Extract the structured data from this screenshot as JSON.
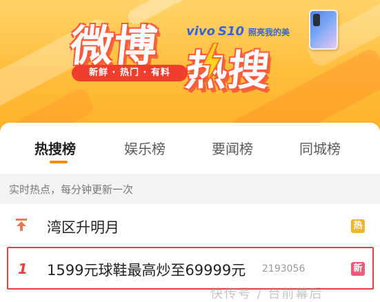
{
  "banner": {
    "title_part1": "微博",
    "title_part2": "热搜",
    "slogan": "新鲜 · 热门 · 有料",
    "sponsor_brand": "vivo",
    "sponsor_model": "S10",
    "sponsor_slogan": "照亮我的美"
  },
  "tabs": [
    {
      "label": "热搜榜",
      "active": true
    },
    {
      "label": "娱乐榜",
      "active": false
    },
    {
      "label": "要闻榜",
      "active": false
    },
    {
      "label": "同城榜",
      "active": false
    }
  ],
  "subtitle": "实时热点，每分钟更新一次",
  "items": [
    {
      "rank": "",
      "title": "湾区升明月",
      "count": "",
      "badge": "热",
      "badge_color": "#f0b52f"
    },
    {
      "rank": "1",
      "title": "1599元球鞋最高炒至69999元",
      "count": "2193056",
      "badge": "新",
      "badge_color": "#ee5a7a"
    }
  ],
  "colors": {
    "accent": "#ff8a1a",
    "highlight_border": "#e0413b",
    "top_icon": "#ea7a55"
  },
  "watermark": "快传号 / 台前幕后"
}
